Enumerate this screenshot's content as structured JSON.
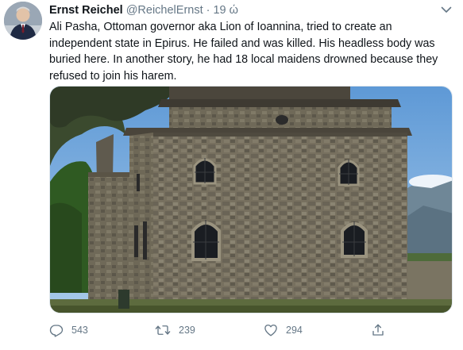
{
  "tweet": {
    "author_name": "Ernst Reichel",
    "handle": "@ReichelErnst",
    "separator": "·",
    "time": "19 ώ",
    "text": "Ali Pasha, Ottoman governor aka Lion of Ioannina, tried to create an independent state in Epirus. He failed and was killed. His headless body was buried here. In another story, he had 18 local maidens drowned because they refused to join his harem.",
    "media_icon": "photo-of-stone-building"
  },
  "actions": {
    "reply_count": "543",
    "retweet_count": "239",
    "like_count": "294",
    "icons": [
      "reply-icon",
      "retweet-icon",
      "like-icon",
      "share-icon"
    ]
  },
  "colors": {
    "text": "#0f1419",
    "muted": "#657786",
    "border": "#e1e8ed"
  }
}
